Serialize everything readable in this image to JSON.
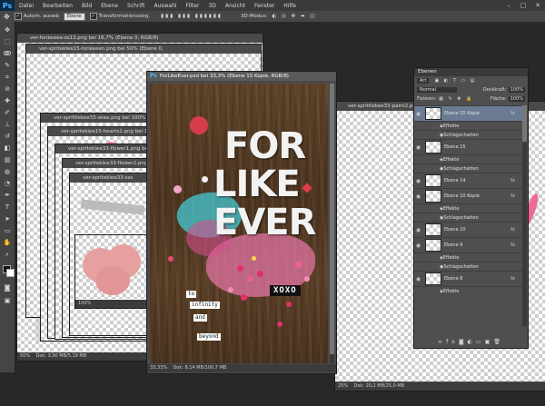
{
  "app": {
    "logo": "Ps"
  },
  "menu": [
    "Datei",
    "Bearbeiten",
    "Bild",
    "Ebene",
    "Schrift",
    "Auswahl",
    "Filter",
    "3D",
    "Ansicht",
    "Fenster",
    "Hilfe"
  ],
  "options": {
    "auto_select_label": "Autom. auswä",
    "auto_select_value": "Ebene",
    "transform_label": "Transformationsstrg.",
    "mode_3d_label": "3D-Modus:"
  },
  "documents": {
    "doc1_title": "ver-fonkeeee-ss13.png bei 16,7% (Ebene 0, RGB/8)",
    "doc2_title": "ver-spriteklee15-tonkeeen.png bei 50% (Ebene 0,",
    "doc3_title": "ver-sprittlekee33-wiee.png bei 100% (Ebene 0,",
    "doc4_title": "ver-spriteklee15-hearts2.png bei 100% (E",
    "doc5_title": "ver-spriteklee33-flower1.png bei 100%",
    "doc6_title": "ver-spriteklee33-flower2.png bei 1",
    "doc7_title": "ver-spriteklee33-sss",
    "doc_right_title": "ver-sprittlekee33-paint2.png bei 25% (Ebene 0, RGB/8)",
    "main_title": "ForLikeEver.psd bei 33,3% (Ebene 15 Kopie, RGB/8)",
    "status_left": "50%",
    "status_left_doc": "Dok: 3,90 MB/5,19 MB",
    "status_mid_zoom": "100%",
    "status_main_zoom": "33,33%",
    "status_main_doc": "Dok: 8,14 MB/100,7 MB",
    "status_right_zoom": "25%",
    "status_right_doc": "Dok: 20,2 MB/25,0 MB"
  },
  "artwork": {
    "line1": "FOR",
    "line2": "LIKE",
    "line3": "EVER",
    "xoxo": "XOXO",
    "stamp1": "to",
    "stamp2": "infinity",
    "stamp3": "and",
    "stamp4": "beyond"
  },
  "layers_panel": {
    "title": "Ebenen",
    "search_kind": "Art",
    "blend_mode": "Normal",
    "opacity_label": "Deckkraft:",
    "opacity_value": "100%",
    "fix_label": "Fixieren:",
    "fill_label": "Fläche:",
    "fill_value": "100%",
    "layers": [
      {
        "name": "Ebene 15 Kopie",
        "fx": "fx",
        "selected": true
      },
      {
        "name": "Effekte",
        "sub": true
      },
      {
        "name": "Schlagschatten",
        "sub": true
      },
      {
        "name": "Ebene 15",
        "fx": ""
      },
      {
        "name": "Effekte",
        "sub": true
      },
      {
        "name": "Schlagschatten",
        "sub": true
      },
      {
        "name": "Ebene 14",
        "fx": "fx"
      },
      {
        "name": "Ebene 10 Kopie",
        "fx": "fx"
      },
      {
        "name": "Effekte",
        "sub": true
      },
      {
        "name": "Schlagschatten",
        "sub": true
      },
      {
        "name": "Ebene 10",
        "fx": "fx"
      },
      {
        "name": "Ebene 9",
        "fx": "fx"
      },
      {
        "name": "Effekte",
        "sub": true
      },
      {
        "name": "Schlagschatten",
        "sub": true
      },
      {
        "name": "Ebene 8",
        "fx": "fx"
      },
      {
        "name": "Effekte",
        "sub": true
      }
    ]
  },
  "colors": {
    "accent": "#6a7b93",
    "background": "#282828",
    "wood": "#5a3f25",
    "brand": "#4fb4ff"
  }
}
